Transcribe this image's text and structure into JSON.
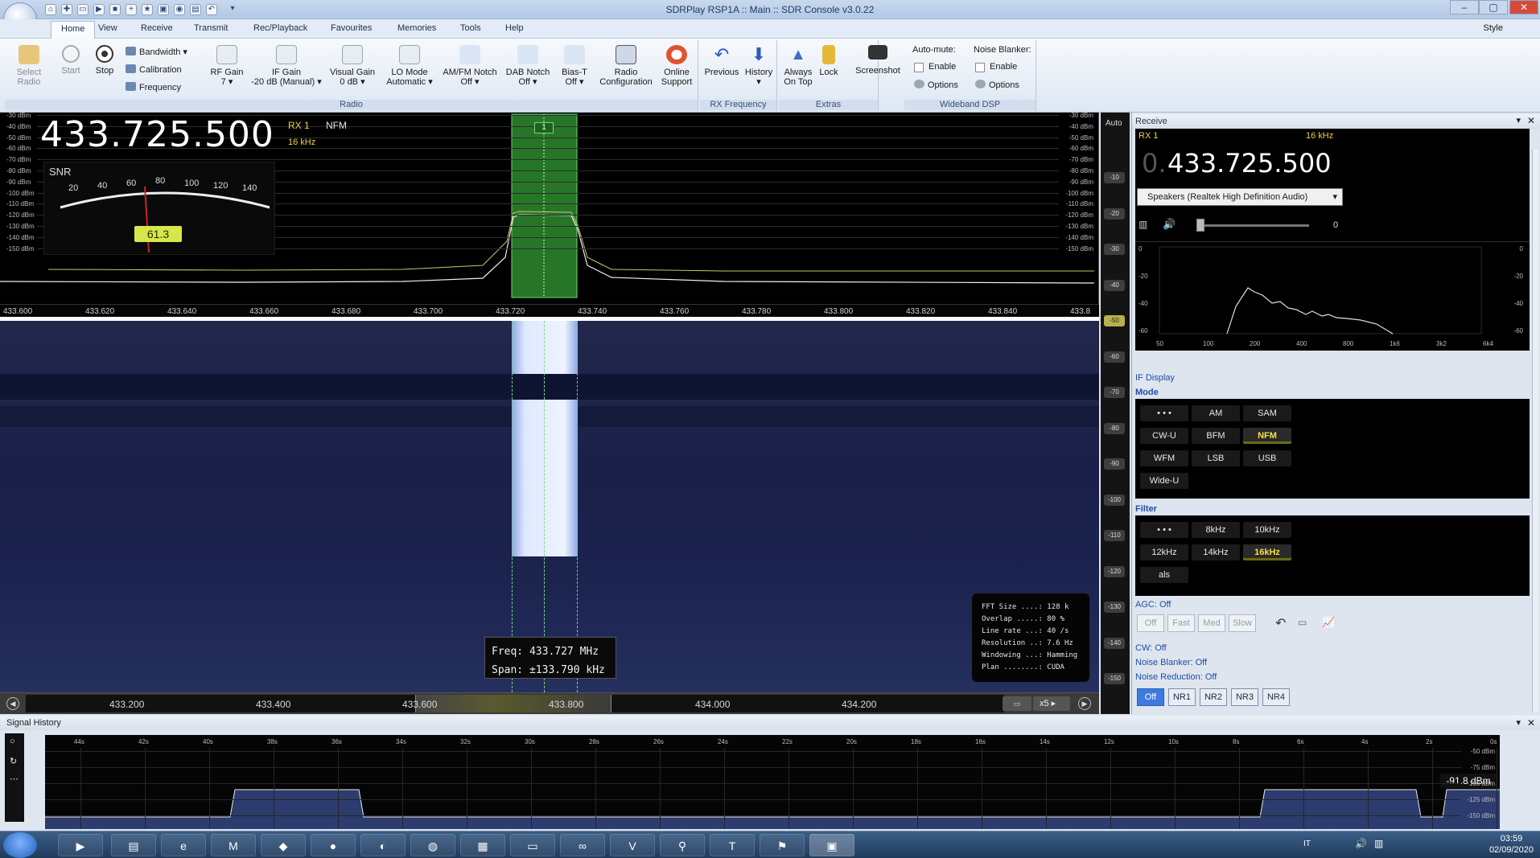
{
  "window": {
    "title": "SDRPlay RSP1A :: Main :: SDR Console v3.0.22"
  },
  "menu": {
    "items": [
      "Home",
      "View",
      "Receive",
      "Transmit",
      "Rec/Playback",
      "Favourites",
      "Memories",
      "Tools",
      "Help"
    ],
    "style": "Style"
  },
  "ribbon": {
    "select_radio": "Select Radio",
    "start": "Start",
    "stop": "Stop",
    "bandwidth": "Bandwidth",
    "calibration": "Calibration",
    "frequency": "Frequency",
    "rf_gain": "RF Gain",
    "rf_gain_val": "7",
    "if_gain": "IF Gain",
    "if_gain_val": "-20 dB (Manual)",
    "visual_gain": "Visual Gain",
    "visual_gain_val": "0 dB",
    "lo_mode": "LO Mode",
    "lo_mode_val": "Automatic",
    "amfm_notch": "AM/FM Notch",
    "amfm_notch_val": "Off",
    "dab_notch": "DAB Notch",
    "dab_notch_val": "Off",
    "biast": "Bias-T",
    "biast_val": "Off",
    "radio_config": "Radio Configuration",
    "radio_config_l1": "Radio",
    "radio_config_l2": "Configuration",
    "online_support": "Online",
    "online_support_l2": "Support",
    "group_radio": "Radio",
    "previous": "Previous",
    "history": "History",
    "group_rxfreq": "RX Frequency",
    "always_on_top_l1": "Always",
    "always_on_top_l2": "On Top",
    "lock": "Lock",
    "screenshot": "Screenshot",
    "group_extras": "Extras",
    "automute": "Auto-mute:",
    "noise_blanker": "Noise Blanker:",
    "enable": "Enable",
    "options": "Options",
    "group_wdsp": "Wideband DSP"
  },
  "spectrum": {
    "frequency": "433.725.500",
    "rx": "RX 1",
    "mode": "NFM",
    "bandwidth": "16 kHz",
    "snr_label": "SNR",
    "snr_value": "61.3",
    "vfo_marker": "1",
    "db_left": [
      "-30 dBm",
      "-40 dBm",
      "-50 dBm",
      "-60 dBm",
      "-70 dBm",
      "-80 dBm",
      "-90 dBm",
      "-100 dBm",
      "-110 dBm",
      "-120 dBm",
      "-130 dBm",
      "-140 dBm",
      "-150 dBm"
    ],
    "db_right": [
      "-30 dBm",
      "-40 dBm",
      "-50 dBm",
      "-60 dBm",
      "-70 dBm",
      "-80 dBm",
      "-90 dBm",
      "-100 dBm",
      "-110 dBm",
      "-120 dBm",
      "-130 dBm",
      "-140 dBm",
      "-150 dBm"
    ],
    "snr_scale": [
      "20",
      "40",
      "60",
      "80",
      "100",
      "120",
      "140"
    ],
    "freq_axis": [
      "433.600",
      "433.620",
      "433.640",
      "433.660",
      "433.680",
      "433.700",
      "433.720",
      "433.740",
      "433.760",
      "433.780",
      "433.800",
      "433.820",
      "433.840",
      "433.8"
    ]
  },
  "waterfall": {
    "fft": [
      "FFT Size ....: 128 k",
      "Overlap .....: 80 %",
      "Line rate ...: 40 /s",
      "Resolution ..: 7.6 Hz",
      "Windowing ...: Hamming",
      "Plan ........: CUDA"
    ],
    "tip_freq": "Freq:  433.727 MHz",
    "tip_span": "Span: ±133.790 kHz",
    "scroll_labels": [
      "433.200",
      "433.400",
      "433.600",
      "433.800",
      "434.000",
      "434.200"
    ],
    "zoom": "x5"
  },
  "colour_scale": {
    "auto": "Auto",
    "labels": [
      "-10",
      "-20",
      "-30",
      "-40",
      "-50",
      "-60",
      "-70",
      "-80",
      "-90",
      "-100",
      "-110",
      "-120",
      "-130",
      "-140",
      "-150"
    ]
  },
  "receive": {
    "title": "Receive",
    "rx": "RX 1",
    "bw": "16 kHz",
    "freq_prefix": "0.",
    "freq": "433.725.500",
    "audio_device": "Speakers (Realtek High Definition Audio)",
    "volume": "0",
    "if_display": "IF Display",
    "mode_title": "Mode",
    "modes": [
      "• • •",
      "AM",
      "SAM",
      "CW-U",
      "BFM",
      "NFM",
      "WFM",
      "LSB",
      "USB",
      "Wide-U"
    ],
    "filter_title": "Filter",
    "filters": [
      "• • •",
      "8kHz",
      "10kHz",
      "12kHz",
      "14kHz",
      "16kHz",
      "als"
    ],
    "agc_title": "AGC: Off",
    "agc": [
      "Off",
      "Fast",
      "Med",
      "Slow"
    ],
    "cw": "CW: Off",
    "noise_blanker": "Noise Blanker: Off",
    "noise_reduction": "Noise Reduction: Off",
    "nr": [
      "Off",
      "NR1",
      "NR2",
      "NR3",
      "NR4"
    ],
    "if_db": [
      "0",
      "-20",
      "-40",
      "-60"
    ],
    "if_freq": [
      "50",
      "100",
      "200",
      "400",
      "800",
      "1k6",
      "3k2",
      "6k4"
    ]
  },
  "signal_history": {
    "title": "Signal History",
    "times": [
      "44s",
      "42s",
      "40s",
      "38s",
      "36s",
      "34s",
      "32s",
      "30s",
      "28s",
      "26s",
      "24s",
      "22s",
      "20s",
      "18s",
      "16s",
      "14s",
      "12s",
      "10s",
      "8s",
      "6s",
      "4s",
      "2s",
      "0s"
    ],
    "db": [
      "-50 dBm",
      "-75 dBm",
      "-100 dBm",
      "-125 dBm",
      "-150 dBm"
    ],
    "readout": "-91.8 dBm"
  },
  "taskbar": {
    "lang": "IT",
    "time": "03:59",
    "date": "02/09/2020"
  },
  "colors": {
    "accent": "#f6e04a",
    "signal": "#2e8b2e",
    "waterfall": "#1a2049"
  }
}
